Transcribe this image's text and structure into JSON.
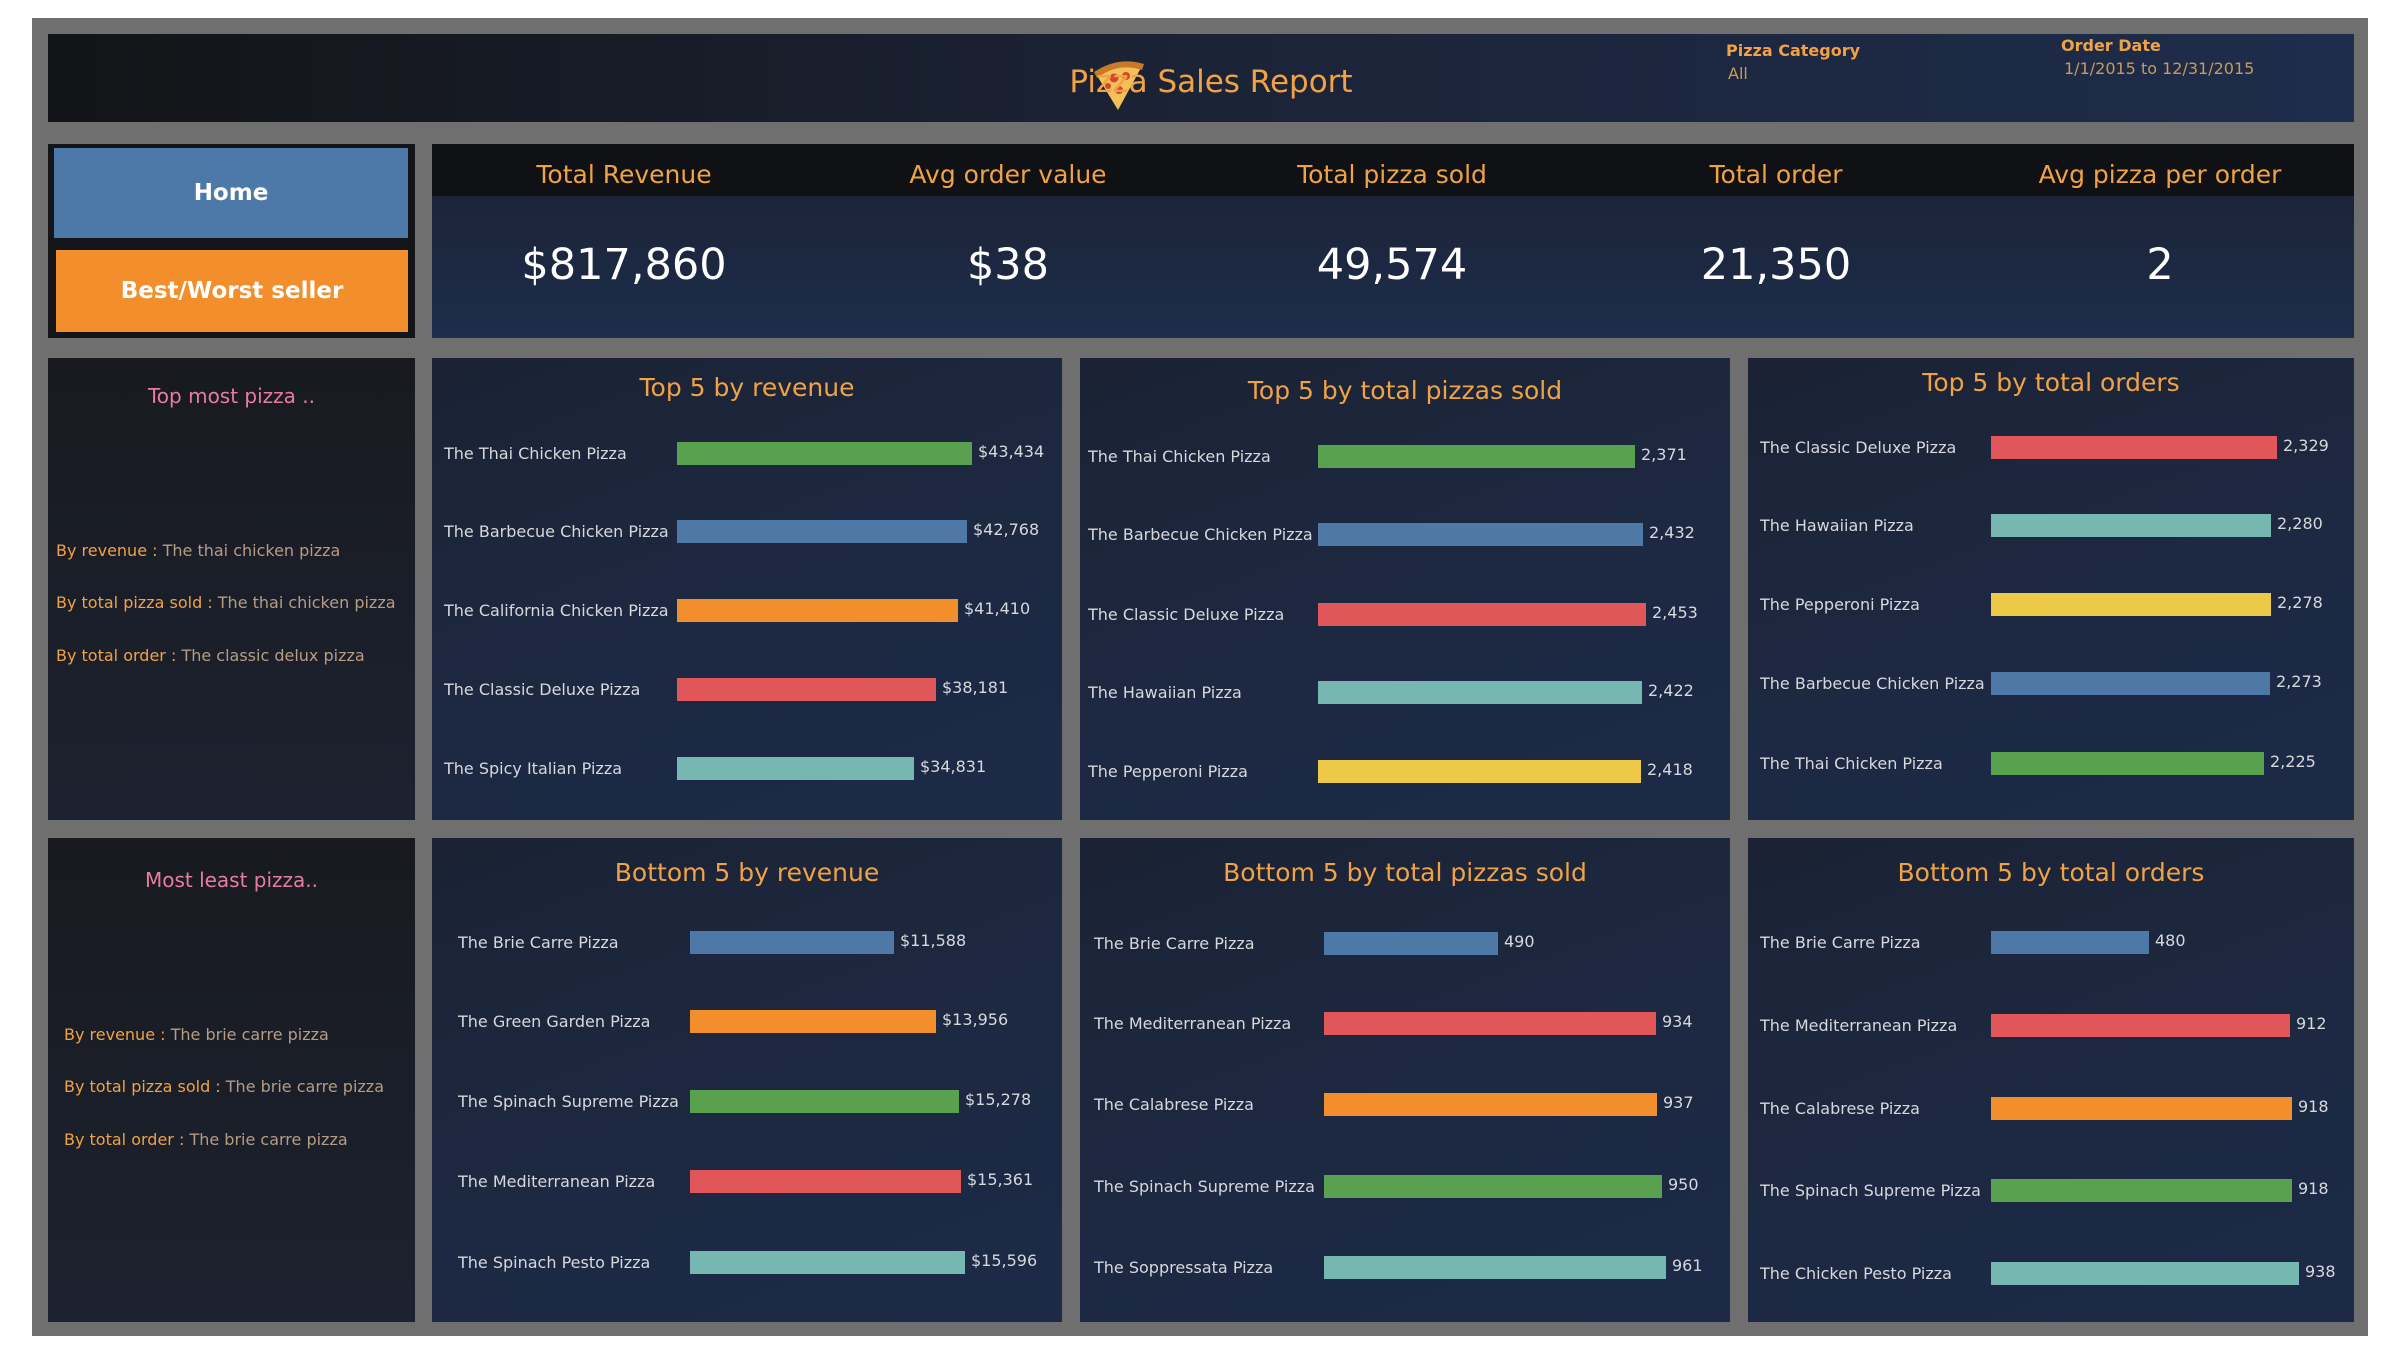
{
  "header": {
    "title": "Pizza Sales Report",
    "filters": [
      {
        "label": "Pizza Category",
        "value": "All"
      },
      {
        "label": "Order Date",
        "value": "1/1/2015 to 12/31/2015"
      }
    ]
  },
  "nav": {
    "home": "Home",
    "best_worst": "Best/Worst seller"
  },
  "kpis": [
    {
      "label": "Total Revenue",
      "value": "$817,860"
    },
    {
      "label": "Avg order value",
      "value": "$38"
    },
    {
      "label": "Total pizza sold",
      "value": "49,574"
    },
    {
      "label": "Total order",
      "value": "21,350"
    },
    {
      "label": "Avg pizza per order",
      "value": "2"
    }
  ],
  "summaries": {
    "top": {
      "title": "Top most pizza ..",
      "lines": [
        {
          "k": "By revenue : ",
          "v": "The thai chicken pizza"
        },
        {
          "k": "By total pizza sold : ",
          "v": "The thai chicken pizza"
        },
        {
          "k": "By total order : ",
          "v": "The classic delux pizza"
        }
      ]
    },
    "bottom": {
      "title": "Most least pizza..",
      "lines": [
        {
          "k": "By revenue : ",
          "v": "The brie carre pizza"
        },
        {
          "k": "By total pizza sold : ",
          "v": "The brie carre pizza"
        },
        {
          "k": "By total order : ",
          "v": "The brie carre pizza"
        }
      ]
    }
  },
  "colors": {
    "green": "#59a14f",
    "blue": "#4e79a7",
    "orange": "#f28e2b",
    "red": "#e15759",
    "teal": "#76b7b2",
    "yellow": "#edc948"
  },
  "chart_data": [
    {
      "type": "bar",
      "title": "Top 5 by revenue",
      "categories": [
        "The Thai Chicken Pizza",
        "The Barbecue Chicken Pizza",
        "The California Chicken Pizza",
        "The Classic Deluxe Pizza",
        "The Spicy Italian Pizza"
      ],
      "values": [
        43434,
        42768,
        41410,
        38181,
        34831
      ],
      "labels": [
        "$43,434",
        "$42,768",
        "$41,410",
        "$38,181",
        "$34,831"
      ],
      "colors": [
        "#59a14f",
        "#4e79a7",
        "#f28e2b",
        "#e15759",
        "#76b7b2"
      ]
    },
    {
      "type": "bar",
      "title": "Top 5 by total pizzas sold",
      "categories": [
        "The Thai Chicken Pizza",
        "The Barbecue Chicken Pizza",
        "The Classic Deluxe Pizza",
        "The Hawaiian Pizza",
        "The Pepperoni Pizza"
      ],
      "values": [
        2371,
        2432,
        2453,
        2422,
        2418
      ],
      "labels": [
        "2,371",
        "2,432",
        "2,453",
        "2,422",
        "2,418"
      ],
      "colors": [
        "#59a14f",
        "#4e79a7",
        "#e15759",
        "#76b7b2",
        "#edc948"
      ]
    },
    {
      "type": "bar",
      "title": "Top 5 by total orders",
      "categories": [
        "The Classic Deluxe Pizza",
        "The Hawaiian Pizza",
        "The Pepperoni Pizza",
        "The Barbecue Chicken Pizza",
        "The Thai Chicken Pizza"
      ],
      "values": [
        2329,
        2280,
        2278,
        2273,
        2225
      ],
      "labels": [
        "2,329",
        "2,280",
        "2,278",
        "2,273",
        "2,225"
      ],
      "colors": [
        "#e15759",
        "#76b7b2",
        "#edc948",
        "#4e79a7",
        "#59a14f"
      ]
    },
    {
      "type": "bar",
      "title": "Bottom 5 by revenue",
      "categories": [
        "The Brie Carre Pizza",
        "The Green Garden Pizza",
        "The Spinach Supreme Pizza",
        "The Mediterranean Pizza",
        "The Spinach Pesto Pizza"
      ],
      "values": [
        11588,
        13956,
        15278,
        15361,
        15596
      ],
      "labels": [
        "$11,588",
        "$13,956",
        "$15,278",
        "$15,361",
        "$15,596"
      ],
      "colors": [
        "#4e79a7",
        "#f28e2b",
        "#59a14f",
        "#e15759",
        "#76b7b2"
      ]
    },
    {
      "type": "bar",
      "title": "Bottom 5 by total pizzas sold",
      "categories": [
        "The Brie Carre Pizza",
        "The Mediterranean Pizza",
        "The Calabrese Pizza",
        "The Spinach Supreme Pizza",
        "The Soppressata Pizza"
      ],
      "values": [
        490,
        934,
        937,
        950,
        961
      ],
      "labels": [
        "490",
        "934",
        "937",
        "950",
        "961"
      ],
      "colors": [
        "#4e79a7",
        "#e15759",
        "#f28e2b",
        "#59a14f",
        "#76b7b2"
      ]
    },
    {
      "type": "bar",
      "title": "Bottom 5 by total orders",
      "categories": [
        "The Brie Carre Pizza",
        "The Mediterranean Pizza",
        "The Calabrese Pizza",
        "The Spinach Supreme Pizza",
        "The Chicken Pesto Pizza"
      ],
      "values": [
        480,
        912,
        918,
        918,
        938
      ],
      "labels": [
        "480",
        "912",
        "918",
        "918",
        "938"
      ],
      "colors": [
        "#4e79a7",
        "#e15759",
        "#f28e2b",
        "#59a14f",
        "#76b7b2"
      ]
    }
  ]
}
